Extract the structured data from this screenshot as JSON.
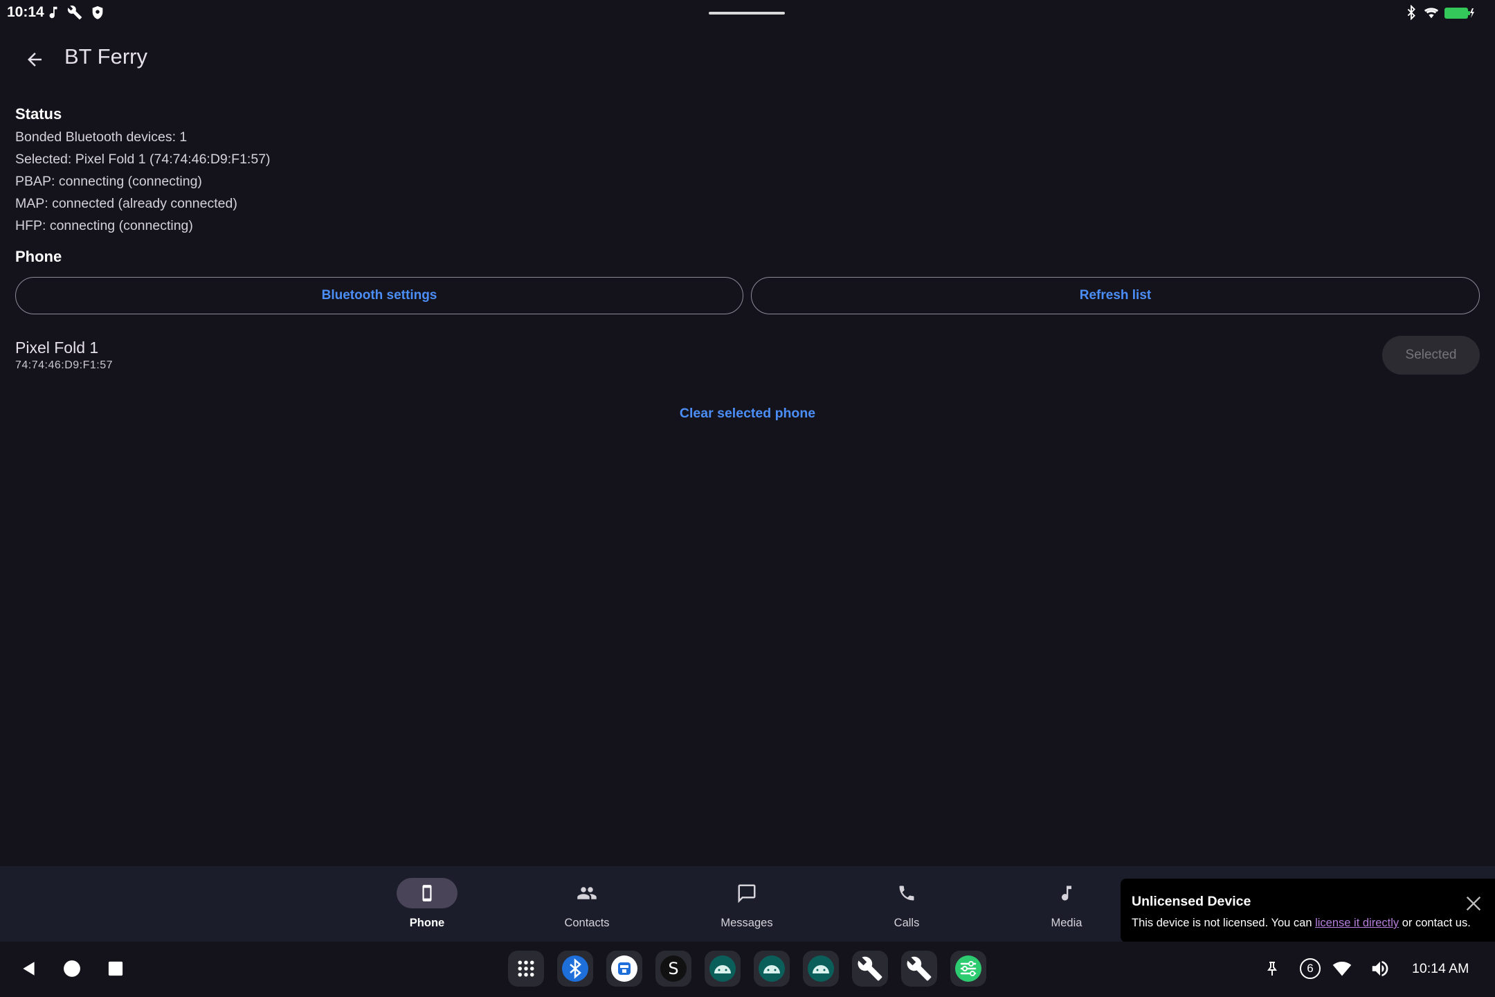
{
  "status_bar": {
    "time": "10:14",
    "left_icons": [
      "music-note-icon",
      "wrench-icon",
      "shield-icon"
    ],
    "right_icons": [
      "bluetooth-icon",
      "wifi-icon",
      "battery-charging-icon"
    ],
    "battery_color": "#34c759"
  },
  "app_bar": {
    "title": "BT Ferry",
    "back_icon": "arrow-back-icon"
  },
  "status": {
    "title": "Status",
    "lines": [
      "Bonded Bluetooth devices: 1",
      "Selected: Pixel Fold 1 (74:74:46:D9:F1:57)",
      "PBAP: connecting (connecting)",
      "MAP: connected (already connected)",
      "HFP: connecting (connecting)"
    ]
  },
  "phone": {
    "title": "Phone",
    "bluetooth_settings_label": "Bluetooth settings",
    "refresh_label": "Refresh list",
    "device": {
      "name": "Pixel Fold 1",
      "address": "74:74:46:D9:F1:57",
      "button_label": "Selected"
    },
    "clear_label": "Clear selected phone"
  },
  "bottom_nav": {
    "items": [
      {
        "label": "Phone",
        "icon": "phone-device-icon",
        "active": true
      },
      {
        "label": "Contacts",
        "icon": "contacts-icon",
        "active": false
      },
      {
        "label": "Messages",
        "icon": "message-icon",
        "active": false
      },
      {
        "label": "Calls",
        "icon": "call-icon",
        "active": false
      },
      {
        "label": "Media",
        "icon": "music-note-icon",
        "active": false
      }
    ]
  },
  "toast": {
    "title": "Unlicensed Device",
    "body_prefix": "This device is not licensed. You can ",
    "link": "license it directly",
    "body_suffix": " or contact us."
  },
  "taskbar": {
    "nav": [
      "back-triangle-icon",
      "home-circle-icon",
      "recents-square-icon"
    ],
    "dock_apps": [
      "app-drawer-icon",
      "bluetooth-app-icon",
      "bt-ferry-app-icon",
      "s-app-icon",
      "android-app-icon",
      "android-app-icon",
      "android-app-icon",
      "wrench-app-icon",
      "wrench-app-icon",
      "settings-tune-app-icon"
    ],
    "notification_count": "6",
    "clock": "10:14 AM"
  },
  "colors": {
    "accent": "#4c8ef7",
    "background": "#14131c",
    "nav_background": "#1b1d2b",
    "link": "#b57edc"
  }
}
